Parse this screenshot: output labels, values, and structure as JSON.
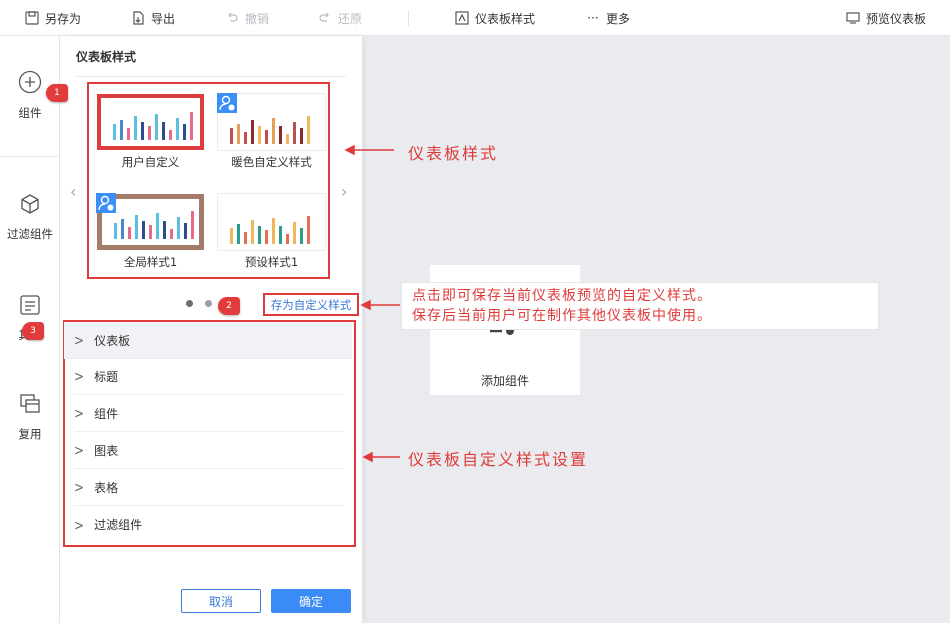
{
  "toolbar": {
    "save_as": "另存为",
    "export": "导出",
    "undo": "撤销",
    "redo": "还原",
    "dashboard_style": "仪表板样式",
    "more": "更多",
    "preview": "预览仪表板"
  },
  "rail": {
    "items": [
      {
        "label": "组件",
        "icon": "plus-circle-icon"
      },
      {
        "label": "过滤组件",
        "icon": "cube-icon"
      },
      {
        "label": "其他",
        "icon": "text-doc-icon"
      },
      {
        "label": "复用",
        "icon": "stack-icon"
      }
    ]
  },
  "panel": {
    "title": "仪表板样式",
    "cards": [
      {
        "label": "用户自定义"
      },
      {
        "label": "暖色自定义样式"
      },
      {
        "label": "全局样式1"
      },
      {
        "label": "预设样式1"
      }
    ],
    "save_custom_link": "存为自定义样式",
    "accordion": [
      {
        "label": "仪表板"
      },
      {
        "label": "标题"
      },
      {
        "label": "组件"
      },
      {
        "label": "图表"
      },
      {
        "label": "表格"
      },
      {
        "label": "过滤组件"
      }
    ],
    "cancel_label": "取消",
    "ok_label": "确定"
  },
  "canvas": {
    "widget_label": "添加组件"
  },
  "annotations": {
    "marker_1": "1",
    "marker_2": "2",
    "marker_3": "3",
    "label_style": "仪表板样式",
    "callout_line1": "点击即可保存当前仪表板预览的自定义样式。",
    "callout_line2": "保存后当前用户可在制作其他仪表板中使用。",
    "label_settings": "仪表板自定义样式设置"
  },
  "colors": {
    "annotation_red": "#e03b3b",
    "primary_blue": "#3a8bf5",
    "selected_border_red": "#dd3c3c",
    "selected_border_brown": "#a47b68"
  }
}
